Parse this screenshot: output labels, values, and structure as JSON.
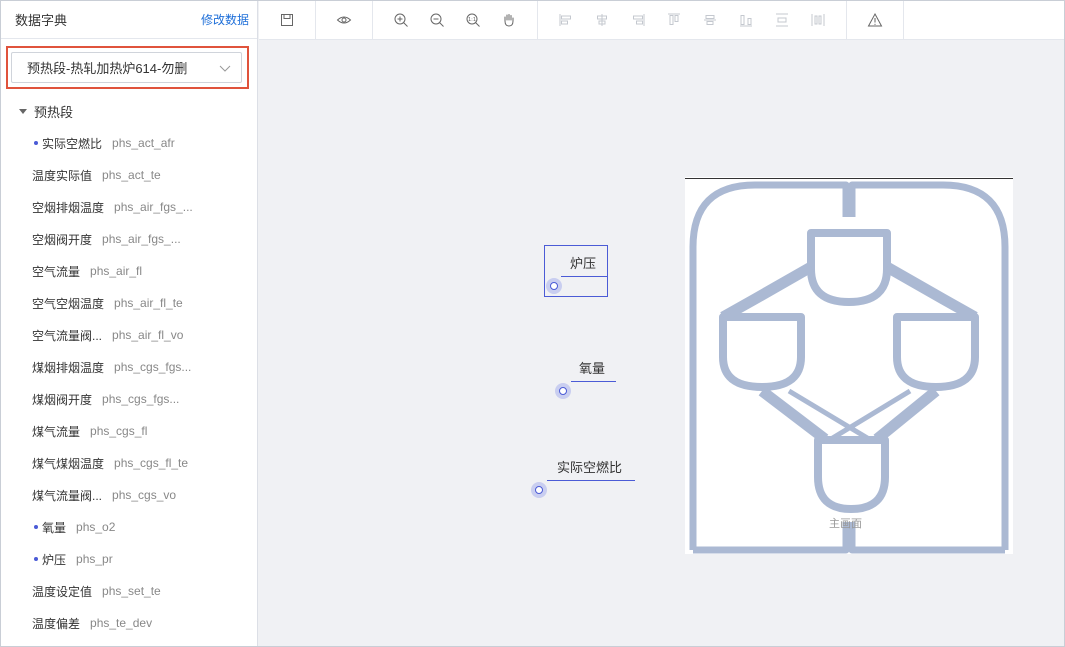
{
  "sidebar": {
    "title": "数据字典",
    "edit_link": "修改数据",
    "selected_section": "预热段-热轧加热炉614-勿删",
    "tree_root": "预热段",
    "items": [
      {
        "label": "实际空燃比",
        "code": "phs_act_afr",
        "marked": true
      },
      {
        "label": "温度实际值",
        "code": "phs_act_te",
        "marked": false
      },
      {
        "label": "空烟排烟温度",
        "code": "phs_air_fgs_...",
        "marked": false
      },
      {
        "label": "空烟阀开度",
        "code": "phs_air_fgs_...",
        "marked": false
      },
      {
        "label": "空气流量",
        "code": "phs_air_fl",
        "marked": false
      },
      {
        "label": "空气空烟温度",
        "code": "phs_air_fl_te",
        "marked": false
      },
      {
        "label": "空气流量阀...",
        "code": "phs_air_fl_vo",
        "marked": false
      },
      {
        "label": "煤烟排烟温度",
        "code": "phs_cgs_fgs...",
        "marked": false
      },
      {
        "label": "煤烟阀开度",
        "code": "phs_cgs_fgs...",
        "marked": false
      },
      {
        "label": "煤气流量",
        "code": "phs_cgs_fl",
        "marked": false
      },
      {
        "label": "煤气煤烟温度",
        "code": "phs_cgs_fl_te",
        "marked": false
      },
      {
        "label": "煤气流量阀...",
        "code": "phs_cgs_vo",
        "marked": false
      },
      {
        "label": "氧量",
        "code": "phs_o2",
        "marked": true
      },
      {
        "label": "炉压",
        "code": "phs_pr",
        "marked": true
      },
      {
        "label": "温度设定值",
        "code": "phs_set_te",
        "marked": false
      },
      {
        "label": "温度偏差",
        "code": "phs_te_dev",
        "marked": false
      }
    ]
  },
  "toolbar": {
    "buttons": [
      {
        "name": "save-icon",
        "enabled": true
      },
      {
        "name": "preview-eye-icon",
        "enabled": true
      },
      {
        "name": "zoom-in-icon",
        "enabled": true
      },
      {
        "name": "zoom-out-icon",
        "enabled": true
      },
      {
        "name": "zoom-fit-icon",
        "enabled": true
      },
      {
        "name": "pan-hand-icon",
        "enabled": true
      },
      {
        "name": "align-left-icon",
        "enabled": false
      },
      {
        "name": "align-center-horizontal-icon",
        "enabled": false
      },
      {
        "name": "align-right-icon",
        "enabled": false
      },
      {
        "name": "align-top-icon",
        "enabled": false
      },
      {
        "name": "align-middle-vertical-icon",
        "enabled": false
      },
      {
        "name": "align-bottom-icon",
        "enabled": false
      },
      {
        "name": "distribute-vertical-icon",
        "enabled": false
      },
      {
        "name": "distribute-horizontal-icon",
        "enabled": false
      },
      {
        "name": "warning-triangle-icon",
        "enabled": true
      }
    ]
  },
  "canvas": {
    "nodes": [
      {
        "label": "炉压",
        "selected": true
      },
      {
        "label": "氧量",
        "selected": false
      },
      {
        "label": "实际空燃比",
        "selected": false
      }
    ],
    "diagram_caption": "主画面"
  },
  "colors": {
    "accent": "#4b5bd6",
    "link": "#1e6fd9",
    "highlight_border": "#e0533c",
    "diagram_pipe": "#abb9d3",
    "canvas_bg": "#f0f1f4"
  }
}
